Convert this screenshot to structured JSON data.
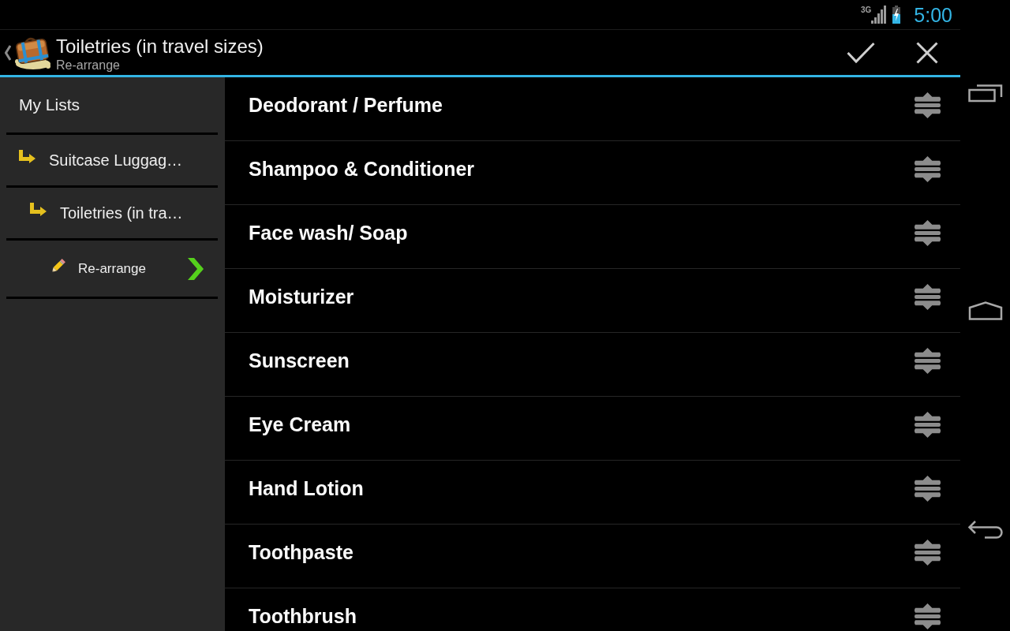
{
  "status_bar": {
    "network": "3G",
    "time": "5:00"
  },
  "action_bar": {
    "title": "Toiletries (in travel sizes)",
    "subtitle": "Re-arrange"
  },
  "sidebar": {
    "title": "My Lists",
    "items": [
      {
        "kind": "list",
        "label": "Suitcase Luggag…",
        "children": [
          {
            "kind": "list",
            "label": "Toiletries (in tra…",
            "children": [
              {
                "kind": "action",
                "label": "Re-arrange"
              }
            ]
          }
        ]
      }
    ]
  },
  "items": [
    {
      "label": "Deodorant / Perfume"
    },
    {
      "label": "Shampoo & Conditioner"
    },
    {
      "label": "Face wash/ Soap"
    },
    {
      "label": "Moisturizer"
    },
    {
      "label": "Sunscreen"
    },
    {
      "label": "Eye Cream"
    },
    {
      "label": "Hand Lotion"
    },
    {
      "label": "Toothpaste"
    },
    {
      "label": "Toothbrush"
    }
  ]
}
